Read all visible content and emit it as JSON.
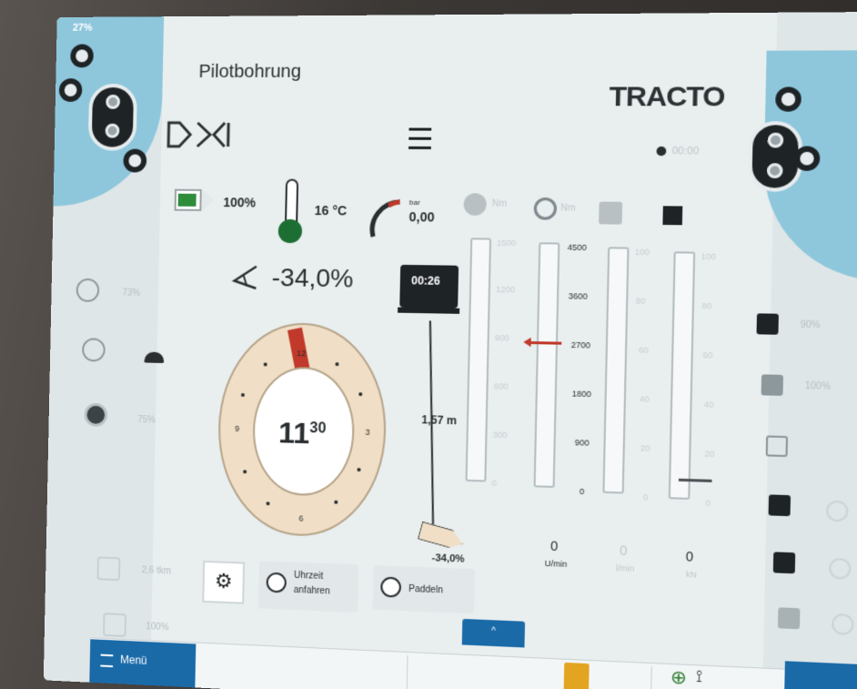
{
  "colors": {
    "screen_bg": "#e9eeef",
    "accent_blue": "#1a6aa8",
    "battery_green": "#2e8d3b",
    "clock_red": "#c0392b",
    "clock_ring": "#f0dfc6",
    "warning": "#e3a521"
  },
  "top_left": {
    "status_pct": "27%"
  },
  "header": {
    "title": "Pilotbohrung",
    "brand": "TRACTO",
    "logo_text": "DCI",
    "timer": "00:00"
  },
  "status_row": {
    "battery_pct": 0.85,
    "battery": "100%",
    "temperature": "16 °C",
    "pressure_unit": "bar",
    "pressure": "0,00",
    "faint_icon_label": "Nm",
    "rotation_unit": "Nm"
  },
  "left_panel": {
    "items": [
      {
        "icon": "clock-icon",
        "value": "73%"
      },
      {
        "icon": "timer-icon",
        "value": ""
      },
      {
        "icon": "record-icon",
        "value": "75%"
      },
      {
        "icon": "bucket-icon",
        "value": "2,6 tkm"
      },
      {
        "icon": "cylinder-icon",
        "value": "100%"
      }
    ],
    "turtle_icon": "turtle-icon"
  },
  "pitch": {
    "icon": "pitch-angle-icon",
    "value": "-34,0%"
  },
  "clock": {
    "hour": "11",
    "minute": "30",
    "labels": {
      "top": "12",
      "right": "3",
      "bottom": "6",
      "left": "9"
    }
  },
  "drill": {
    "time": "00:26",
    "distance": "1,57 m",
    "head_pitch": "-34,0%"
  },
  "scales": [
    {
      "name": "scale-1",
      "labels": [
        "1500",
        "1200",
        "900",
        "600",
        "300",
        "0"
      ],
      "faint": true
    },
    {
      "name": "scale-2",
      "labels": [
        "4500",
        "3600",
        "2700",
        "1800",
        "900",
        "0"
      ],
      "faint": false
    },
    {
      "name": "scale-3",
      "labels": [
        "100",
        "80",
        "60",
        "40",
        "20",
        "0"
      ],
      "faint": true
    },
    {
      "name": "scale-4",
      "labels": [
        "100",
        "80",
        "60",
        "40",
        "20",
        "0"
      ],
      "faint": true
    }
  ],
  "readouts": [
    {
      "value": "0",
      "unit": "U/min"
    },
    {
      "value": "0",
      "unit": "l/min"
    },
    {
      "value": "0",
      "unit": "kN"
    }
  ],
  "bottom": {
    "settings_icon": "gear-icon",
    "option1_line1": "Uhrzeit",
    "option1_line2": "anfahren",
    "option2": "Paddeln",
    "up_tab": "^"
  },
  "statusbar": {
    "menu": "Menü",
    "warning_icon": "warning-icon",
    "gps_icon": "gps-icon",
    "radio_icon": "radio-icon"
  },
  "right_panel": {
    "items": [
      "90%",
      "100%"
    ]
  }
}
